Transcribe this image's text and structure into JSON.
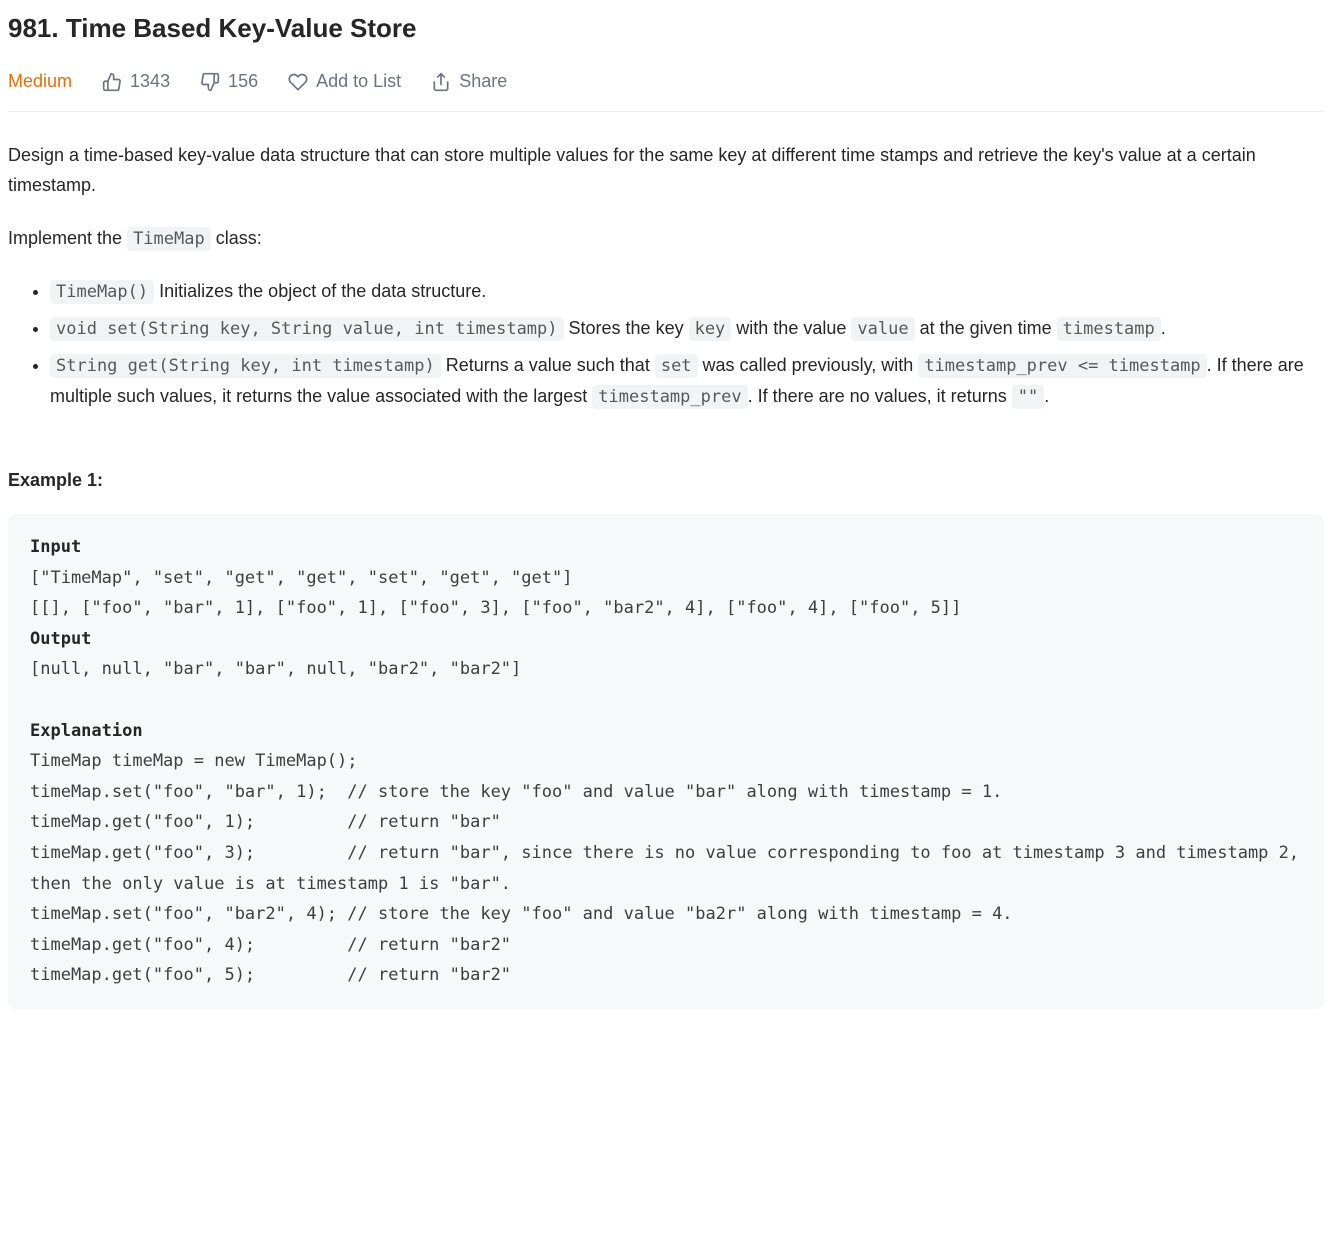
{
  "header": {
    "title": "981. Time Based Key-Value Store",
    "difficulty": "Medium",
    "likes": "1343",
    "dislikes": "156",
    "add_to_list": "Add to List",
    "share": "Share"
  },
  "description": {
    "p1": "Design a time-based key-value data structure that can store multiple values for the same key at different time stamps and retrieve the key's value at a certain timestamp.",
    "p2_pre": "Implement the ",
    "p2_code": "TimeMap",
    "p2_post": " class:"
  },
  "api": {
    "i0_code": "TimeMap()",
    "i0_text": " Initializes the object of the data structure.",
    "i1_code": "void set(String key, String value, int timestamp)",
    "i1_t1": " Stores the key ",
    "i1_c1": "key",
    "i1_t2": " with the value ",
    "i1_c2": "value",
    "i1_t3": " at the given time ",
    "i1_c3": "timestamp",
    "i1_t4": ".",
    "i2_code": "String get(String key, int timestamp)",
    "i2_t1": " Returns a value such that ",
    "i2_c1": "set",
    "i2_t2": " was called previously, with ",
    "i2_c2": "timestamp_prev <= timestamp",
    "i2_t3": ". If there are multiple such values, it returns the value associated with the largest ",
    "i2_c3": "timestamp_prev",
    "i2_t4": ". If there are no values, it returns ",
    "i2_c4": "\"\"",
    "i2_t5": "."
  },
  "example": {
    "label": "Example 1:",
    "l_input": "Input",
    "input1": "[\"TimeMap\", \"set\", \"get\", \"get\", \"set\", \"get\", \"get\"]",
    "input2": "[[], [\"foo\", \"bar\", 1], [\"foo\", 1], [\"foo\", 3], [\"foo\", \"bar2\", 4], [\"foo\", 4], [\"foo\", 5]]",
    "l_output": "Output",
    "output1": "[null, null, \"bar\", \"bar\", null, \"bar2\", \"bar2\"]",
    "l_explanation": "Explanation",
    "ex1": "TimeMap timeMap = new TimeMap();",
    "ex2": "timeMap.set(\"foo\", \"bar\", 1);  // store the key \"foo\" and value \"bar\" along with timestamp = 1.",
    "ex3": "timeMap.get(\"foo\", 1);         // return \"bar\"",
    "ex4": "timeMap.get(\"foo\", 3);         // return \"bar\", since there is no value corresponding to foo at timestamp 3 and timestamp 2, then the only value is at timestamp 1 is \"bar\".",
    "ex5": "timeMap.set(\"foo\", \"bar2\", 4); // store the key \"foo\" and value \"ba2r\" along with timestamp = 4.",
    "ex6": "timeMap.get(\"foo\", 4);         // return \"bar2\"",
    "ex7": "timeMap.get(\"foo\", 5);         // return \"bar2\""
  }
}
